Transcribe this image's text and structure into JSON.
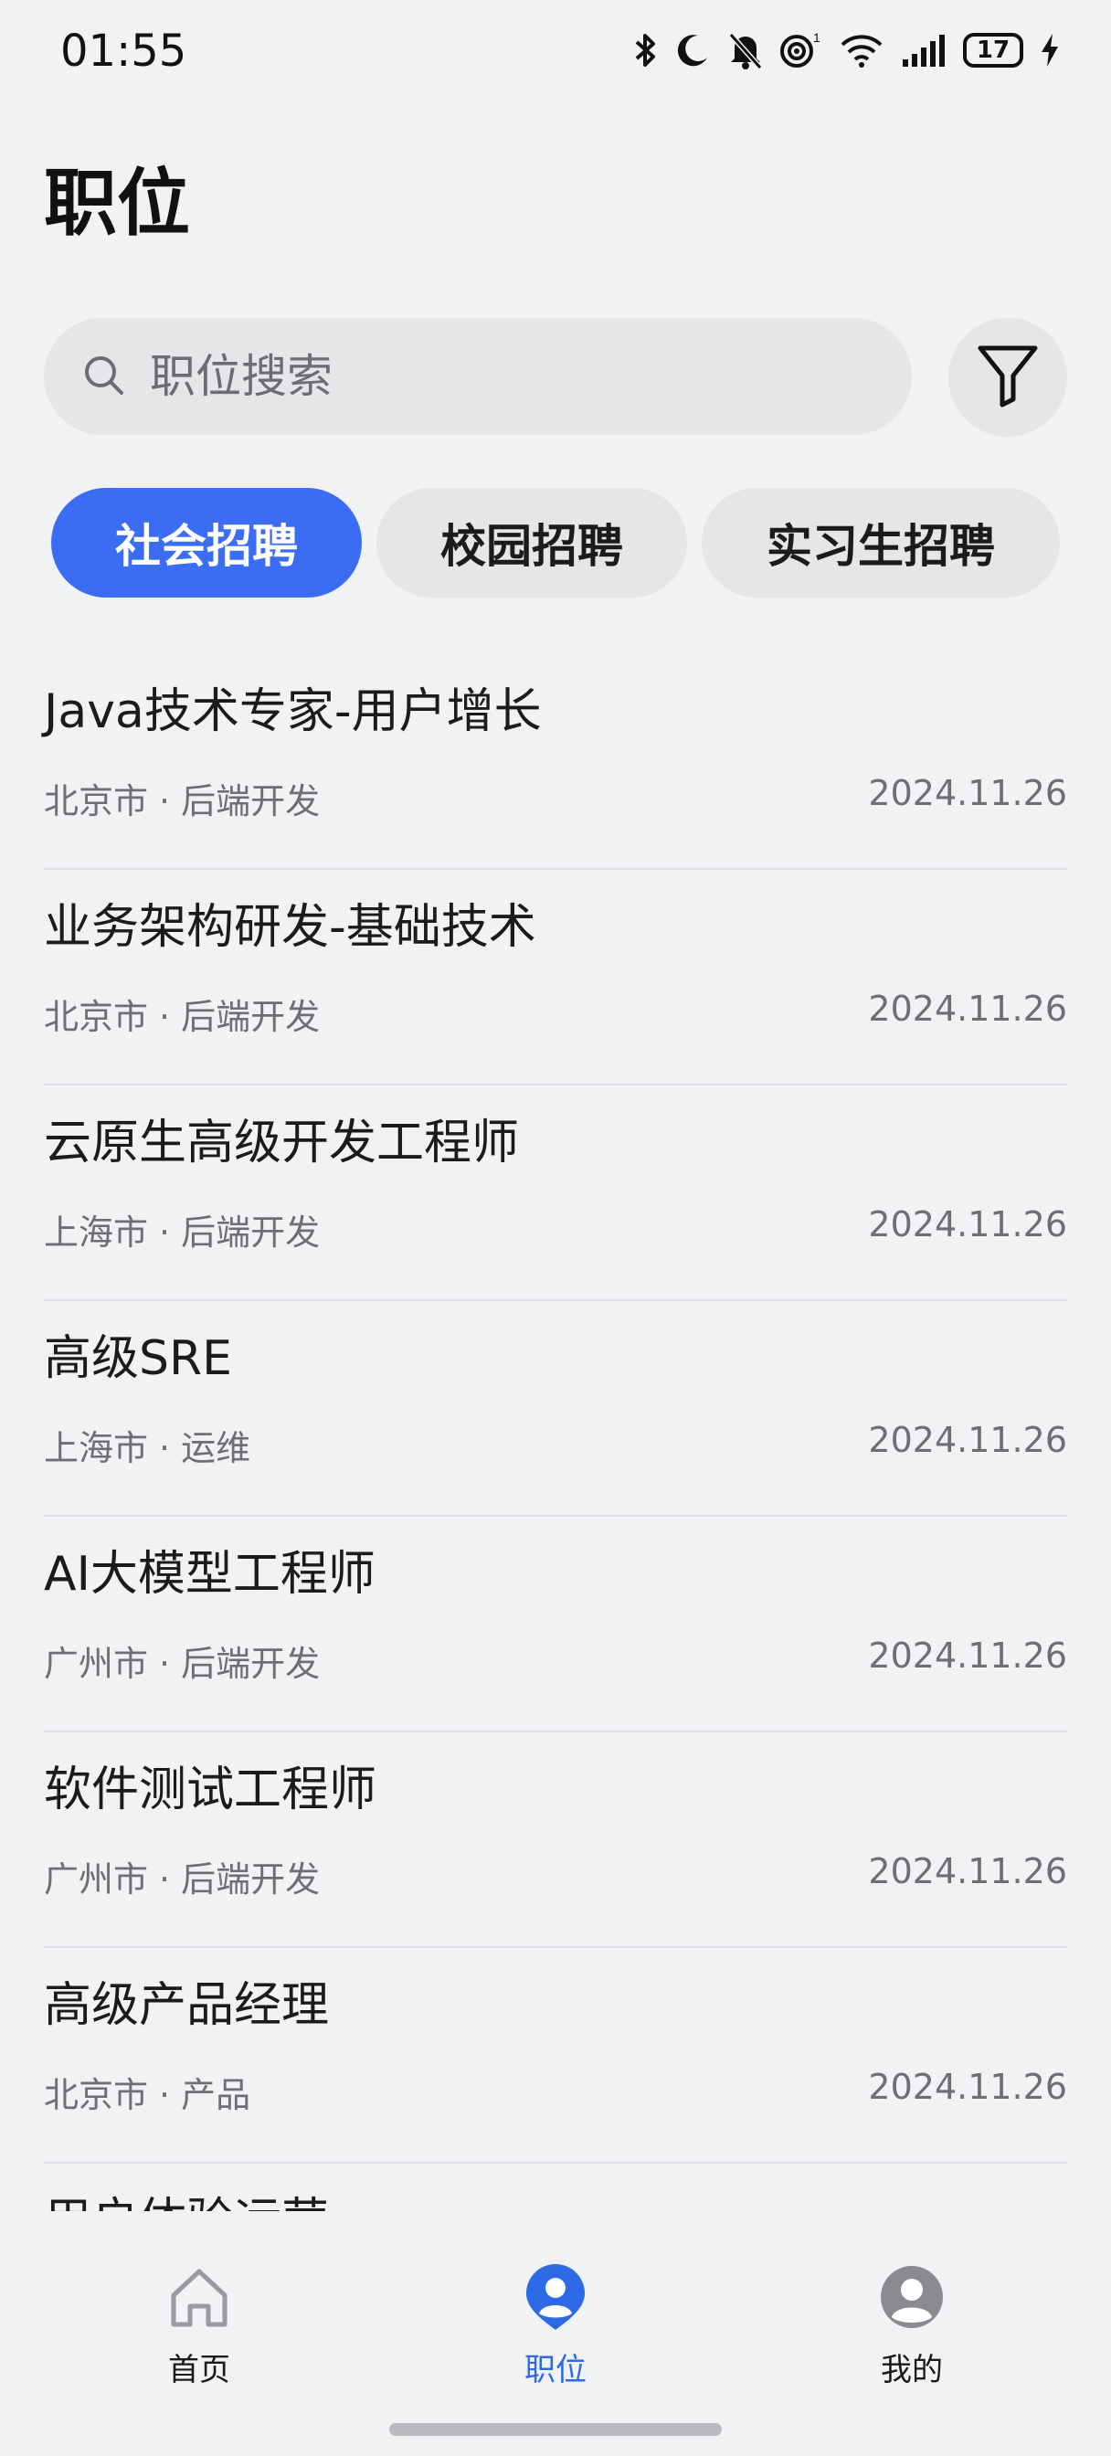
{
  "status_bar": {
    "time": "01:55",
    "battery": "17"
  },
  "page": {
    "title": "职位"
  },
  "search": {
    "placeholder": "职位搜索"
  },
  "tabs": [
    {
      "label": "社会招聘",
      "active": true
    },
    {
      "label": "校园招聘",
      "active": false
    },
    {
      "label": "实习生招聘",
      "active": false
    }
  ],
  "jobs": [
    {
      "title": "Java技术专家-用户增长",
      "city": "北京市",
      "separator": "·",
      "category": "后端开发",
      "date": "2024.11.26"
    },
    {
      "title": "业务架构研发-基础技术",
      "city": "北京市",
      "separator": "·",
      "category": "后端开发",
      "date": "2024.11.26"
    },
    {
      "title": "云原生高级开发工程师",
      "city": "上海市",
      "separator": "·",
      "category": "后端开发",
      "date": "2024.11.26"
    },
    {
      "title": "高级SRE",
      "city": "上海市",
      "separator": "·",
      "category": "运维",
      "date": "2024.11.26"
    },
    {
      "title": "AI大模型工程师",
      "city": "广州市",
      "separator": "·",
      "category": "后端开发",
      "date": "2024.11.26"
    },
    {
      "title": "软件测试工程师",
      "city": "广州市",
      "separator": "·",
      "category": "后端开发",
      "date": "2024.11.26"
    },
    {
      "title": "高级产品经理",
      "city": "北京市",
      "separator": "·",
      "category": "产品",
      "date": "2024.11.26"
    },
    {
      "title": "用户体验运营",
      "city": "",
      "separator": "",
      "category": "",
      "date": ""
    }
  ],
  "bottom_nav": [
    {
      "label": "首页",
      "icon": "home-icon",
      "active": false
    },
    {
      "label": "职位",
      "icon": "position-icon",
      "active": true
    },
    {
      "label": "我的",
      "icon": "profile-icon",
      "active": false
    }
  ],
  "colors": {
    "accent": "#3a6df4",
    "nav_active": "#2f6ae6",
    "background": "#f1f2f4"
  }
}
